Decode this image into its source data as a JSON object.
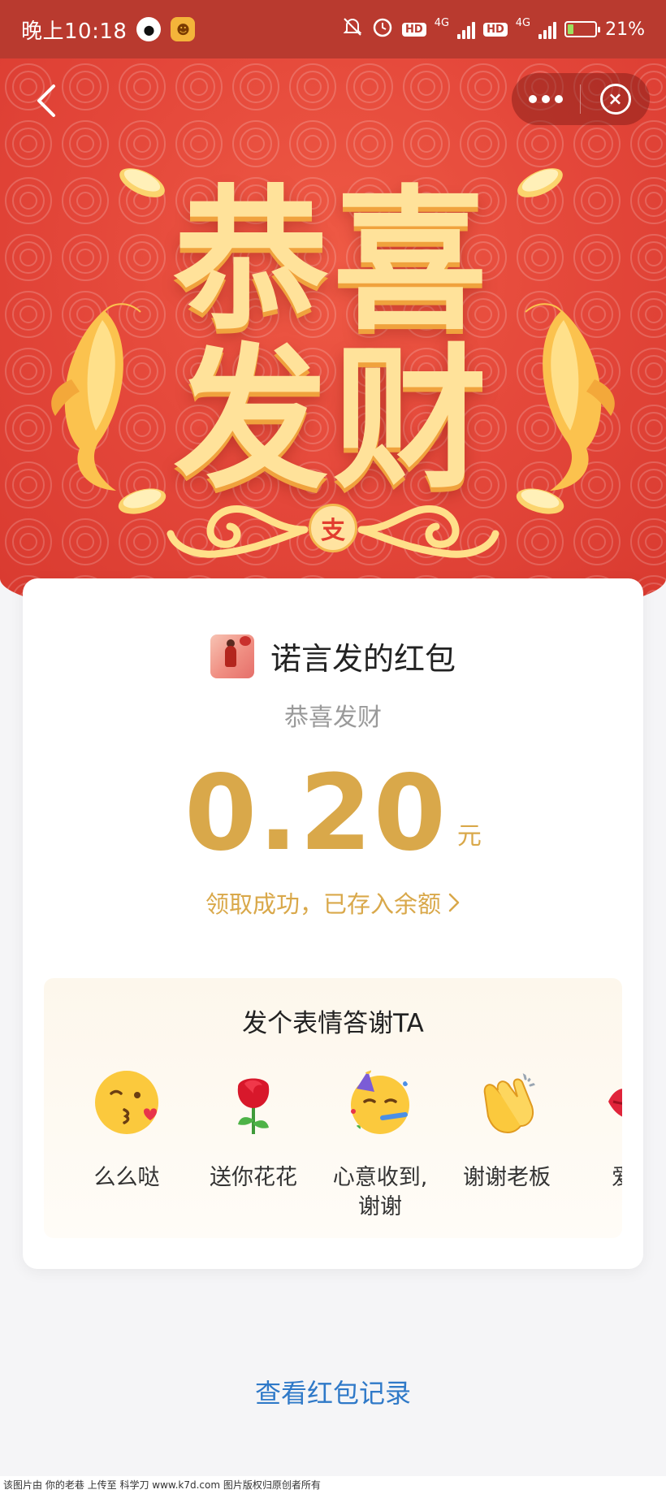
{
  "status_bar": {
    "time": "晚上10:18",
    "network_1": "4G",
    "network_2": "4G",
    "hd_1": "HD",
    "hd_2": "HD",
    "battery": "21%",
    "battery_level": 0.21,
    "icons": [
      "qq-icon",
      "cat-app-icon",
      "mute-bell-icon",
      "alarm-icon",
      "hd-icon",
      "signal-icon",
      "battery-icon"
    ]
  },
  "nav": {
    "back_icon": "chevron-left-icon",
    "more_icon": "more-dots-icon",
    "close_icon": "close-circle-icon",
    "more_label": "•••",
    "close_label": "×",
    "back_label": "‹"
  },
  "banner": {
    "line1": "恭喜",
    "line2": "发财",
    "seal_label": "支",
    "colors": {
      "red": "#e4473a",
      "gold": "#ffe29a",
      "gold_shadow": "#f0a23d"
    }
  },
  "card": {
    "sender_name": "诺言发的红包",
    "blessing": "恭喜发财",
    "amount": "0.20",
    "unit": "元",
    "status_text": "领取成功，已存入余额",
    "status_chevron": "›",
    "accent": "#d9a84a"
  },
  "thanks": {
    "title": "发个表情答谢TA",
    "items": [
      {
        "label": "么么哒",
        "icon": "kissing-face-icon"
      },
      {
        "label": "送你花花",
        "icon": "rose-icon"
      },
      {
        "label": "心意收到,\n谢谢",
        "icon": "party-face-icon"
      },
      {
        "label": "谢谢老板",
        "icon": "clapping-hands-icon"
      },
      {
        "label": "爱你\n么",
        "icon": "lips-icon"
      }
    ]
  },
  "footer": {
    "record_link": "查看红包记录",
    "link_color": "#2f79c8",
    "watermark": "该图片由 你的老巷 上传至 科学刀 www.k7d.com 图片版权归原创者所有"
  }
}
